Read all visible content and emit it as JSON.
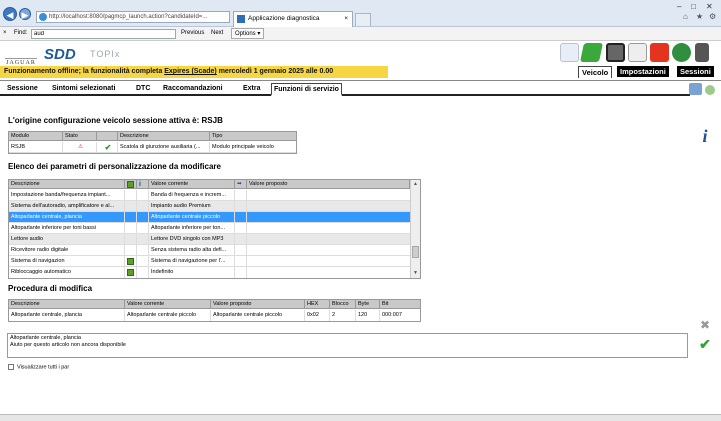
{
  "browser": {
    "url": "http://localhost:8080/pagmcp_launch.action?candidateId=...",
    "tab_title": "Applicazione diagnostica",
    "tab_close": "×",
    "back": "◀",
    "forward": "▶",
    "win_min": "–",
    "win_max": "□",
    "win_close": "✕",
    "home": "⌂",
    "fav": "★",
    "settings": "⚙"
  },
  "findbar": {
    "close": "×",
    "label": "Find:",
    "value": "aud",
    "previous": "Previous",
    "next": "Next",
    "options": "Options ▾"
  },
  "header": {
    "brand_jaguar": "JAGUAR",
    "brand_sdd": "SDD",
    "brand_topix": "TOPIx",
    "banner_pre": "Funzionamento offline; la funzionalità completa ",
    "banner_link": "Expires (Scade)",
    "banner_post": " mercoledì 1 gennaio 2025 alle 0.00",
    "nav": [
      "Veicolo",
      "Impostazioni",
      "Sessioni"
    ]
  },
  "menu": [
    "Sessione",
    "Sintomi selezionati",
    "DTC",
    "Raccomandazioni",
    "Extra",
    "Funzioni di servizio"
  ],
  "section1": {
    "title": "L'origine configurazione veicolo sessione attiva è: RSJB",
    "headers": [
      "Modulo",
      "Stato",
      "",
      "Descrizione",
      "Tipo"
    ],
    "row": {
      "modulo": "RSJB",
      "stato_icon": "⚠",
      "check": "✔",
      "descrizione": "Scatola di giunzione ausiliaria (...",
      "tipo": "Modulo principale veicolo"
    }
  },
  "section2": {
    "title": "Elenco dei parametri di personalizzazione da modificare",
    "headers": [
      "Descrizione",
      "",
      "",
      "Valore corrente",
      "",
      "Valore proposto"
    ],
    "info_icon": "i",
    "arrow_icon": "➡",
    "rows": [
      {
        "descrizione": "Impostazione banda/frequenza impiant...",
        "valore_corrente": "Banda di frequenza e increm...",
        "flag": false
      },
      {
        "descrizione": "Sistema dell'autoradio, amplificatore e al...",
        "valore_corrente": "Impianto audio Premium",
        "flag": false
      },
      {
        "descrizione": "Altoparlante centrale, plancia",
        "valore_corrente": "Altoparlante centrale piccolo",
        "flag": false
      },
      {
        "descrizione": "Altoparlante inferiore per toni bassi",
        "valore_corrente": "Altoparlante inferiore per ton...",
        "flag": false
      },
      {
        "descrizione": "Lettore audio",
        "valore_corrente": "Lettore DVD singolo con MP3",
        "flag": false
      },
      {
        "descrizione": "Ricevitore radio digitale",
        "valore_corrente": "Senza sistema radio alta defi...",
        "flag": false
      },
      {
        "descrizione": "Sistema di navigazion",
        "valore_corrente": "Sistema di navigazione per l'...",
        "flag": true
      },
      {
        "descrizione": "Ribloccaggio automatico",
        "valore_corrente": "Indefinito",
        "flag": true
      }
    ],
    "scroll_up": "▲",
    "scroll_down": "▼"
  },
  "section3": {
    "title": "Procedura di modifica",
    "headers": [
      "Descrizione",
      "Valore corrente",
      "Valore proposto",
      "HEX",
      "Blocco",
      "Byte",
      "Bit"
    ],
    "row": {
      "descrizione": "Altoparlante centrale, plancia",
      "valore_corrente": "Altoparlante centrale piccolo",
      "valore_proposto": "Altoparlante centrale piccolo",
      "hex": "0x02",
      "blocco": "2",
      "byte": "120",
      "bit": "000:007"
    }
  },
  "description_box": {
    "line1": "Altoparlante centrale, plancia",
    "line2": "Aiuto per questo articolo non ancora disponibile"
  },
  "show_all_label": "Visualizzare tutti i par",
  "side": {
    "info": "i",
    "cancel": "✖",
    "confirm": "✔"
  },
  "colors": {
    "banner": "#f6d743",
    "selected_row": "#3399ff",
    "header_cell": "#c9c9c9"
  }
}
